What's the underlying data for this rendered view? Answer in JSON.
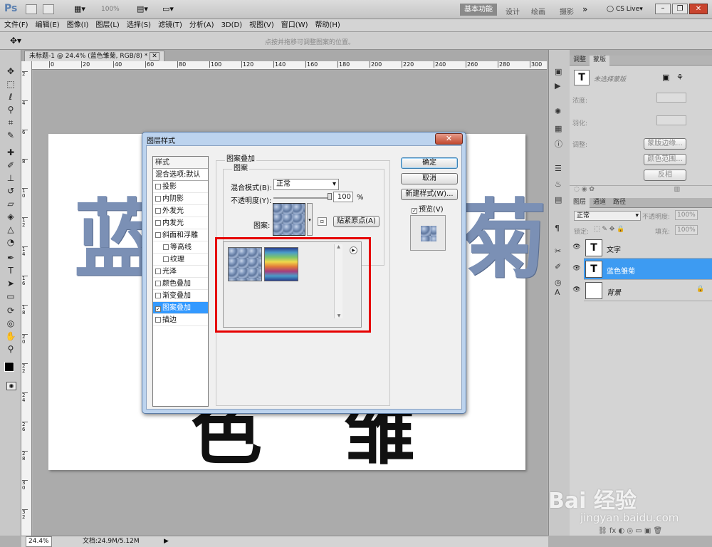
{
  "app": {
    "logo": "Ps",
    "zoom": "100%",
    "workspace_active": "基本功能",
    "workspaces": [
      "设计",
      "绘画",
      "摄影"
    ],
    "more": "»",
    "cslive": "CS Live"
  },
  "menu": [
    "文件(F)",
    "编辑(E)",
    "图像(I)",
    "图层(L)",
    "选择(S)",
    "滤镜(T)",
    "分析(A)",
    "3D(D)",
    "视图(V)",
    "窗口(W)",
    "帮助(H)"
  ],
  "options": {
    "hint": "点按并拖移可调整图案的位置。"
  },
  "document": {
    "tab": "未标题-1 @ 24.4% (蓝色雏菊, RGB/8) *",
    "text_top": "蓝",
    "text_top_right": "菊",
    "text_bottom": "色 雏"
  },
  "ruler": {
    "h": [
      "0",
      "20",
      "40",
      "60",
      "80",
      "100",
      "120",
      "140",
      "160",
      "180",
      "200",
      "220",
      "240",
      "260",
      "280",
      "300"
    ],
    "v": [
      "2",
      "4",
      "6",
      "8",
      "10",
      "12",
      "14",
      "16",
      "18",
      "20",
      "22",
      "24",
      "26",
      "28",
      "30",
      "32"
    ]
  },
  "status": {
    "zoom": "24.4%",
    "doc": "文档:24.9M/5.12M"
  },
  "dialog": {
    "title": "图层样式",
    "close": "✕",
    "styles_header": "样式",
    "blend_options": "混合选项:默认",
    "items": [
      {
        "label": "投影",
        "checked": false,
        "sub": false
      },
      {
        "label": "内阴影",
        "checked": false,
        "sub": false
      },
      {
        "label": "外发光",
        "checked": false,
        "sub": false
      },
      {
        "label": "内发光",
        "checked": false,
        "sub": false
      },
      {
        "label": "斜面和浮雕",
        "checked": false,
        "sub": false
      },
      {
        "label": "等高线",
        "checked": false,
        "sub": true
      },
      {
        "label": "纹理",
        "checked": false,
        "sub": true
      },
      {
        "label": "光泽",
        "checked": false,
        "sub": false
      },
      {
        "label": "颜色叠加",
        "checked": false,
        "sub": false
      },
      {
        "label": "渐变叠加",
        "checked": false,
        "sub": false
      },
      {
        "label": "图案叠加",
        "checked": true,
        "sub": false,
        "selected": true
      },
      {
        "label": "描边",
        "checked": false,
        "sub": false
      }
    ],
    "group_title": "图案叠加",
    "subgroup_title": "图案",
    "blend_mode_label": "混合模式(B):",
    "blend_mode_value": "正常",
    "opacity_label": "不透明度(Y):",
    "opacity_value": "100",
    "opacity_unit": "%",
    "pattern_label": "图案:",
    "snap_button": "贴紧原点(A)",
    "ok": "确定",
    "cancel": "取消",
    "new_style": "新建样式(W)...",
    "preview_label": "预览(V)",
    "preview_checked": true
  },
  "right": {
    "tabs1": [
      "调整",
      "蒙版"
    ],
    "mask_title": "未选择蒙版",
    "density": "浓度:",
    "feather": "羽化:",
    "adjust": "调整:",
    "mask_edge": "蒙版边缘...",
    "color_range": "颜色范围...",
    "invert": "反相",
    "tabs2": [
      "图层",
      "通道",
      "路径"
    ],
    "blend": "正常",
    "opacity_label": "不透明度:",
    "opacity": "100%",
    "lock_label": "锁定:",
    "fill_label": "填充:",
    "fill": "100%",
    "layers": [
      {
        "name": "文字",
        "type": "T",
        "selected": false
      },
      {
        "name": "蓝色雏菊",
        "type": "T",
        "selected": true
      },
      {
        "name": "背景",
        "type": "",
        "selected": false,
        "locked": true
      }
    ]
  },
  "watermark": {
    "brand": "Bai  经验",
    "url": "jingyan.baidu.com"
  }
}
